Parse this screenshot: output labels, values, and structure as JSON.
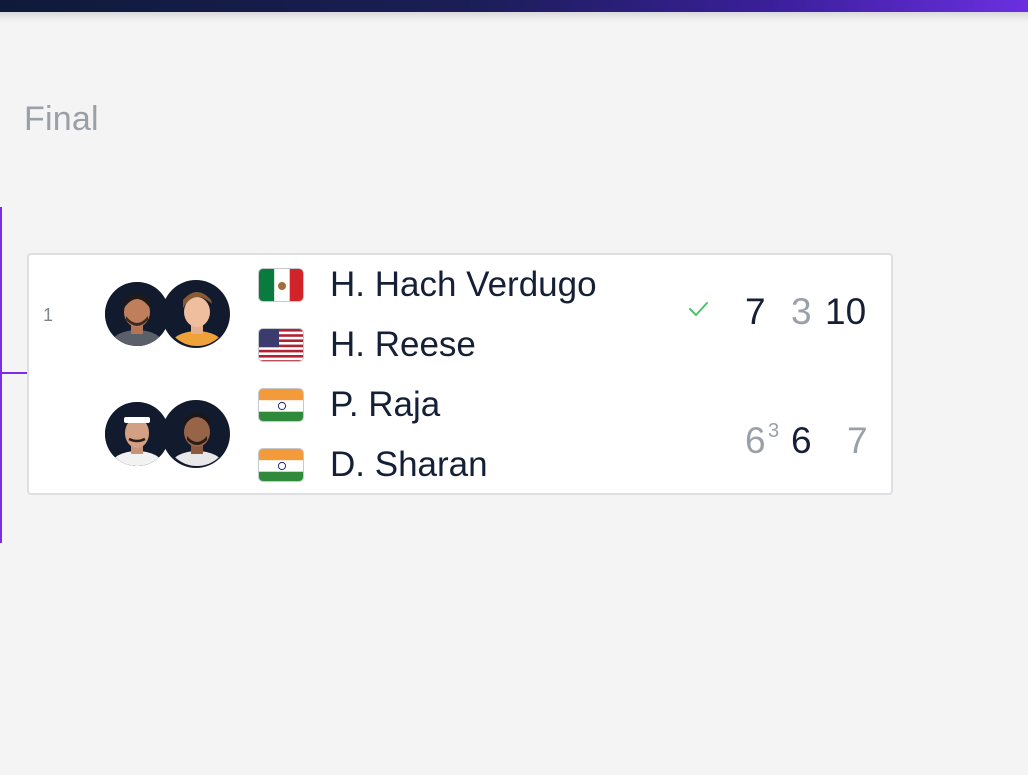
{
  "round": {
    "title": "Final"
  },
  "match": {
    "seed": "1",
    "team1": {
      "players": [
        {
          "name": "H. Hach Verdugo",
          "flag": "mexico-flag"
        },
        {
          "name": "H. Reese",
          "flag": "usa-flag"
        }
      ],
      "winner": true,
      "sets": [
        "7",
        "3",
        "10"
      ]
    },
    "team2": {
      "players": [
        {
          "name": "P. Raja",
          "flag": "india-flag"
        },
        {
          "name": "D. Sharan",
          "flag": "india-flag"
        }
      ],
      "winner": false,
      "sets": [
        "6",
        "6",
        "7"
      ],
      "tiebreak_set1": "3"
    }
  },
  "colors": {
    "accent": "#7a2fe6",
    "win_text": "#152036",
    "lose_text": "#9aa0a8",
    "check": "#4cc36b"
  }
}
